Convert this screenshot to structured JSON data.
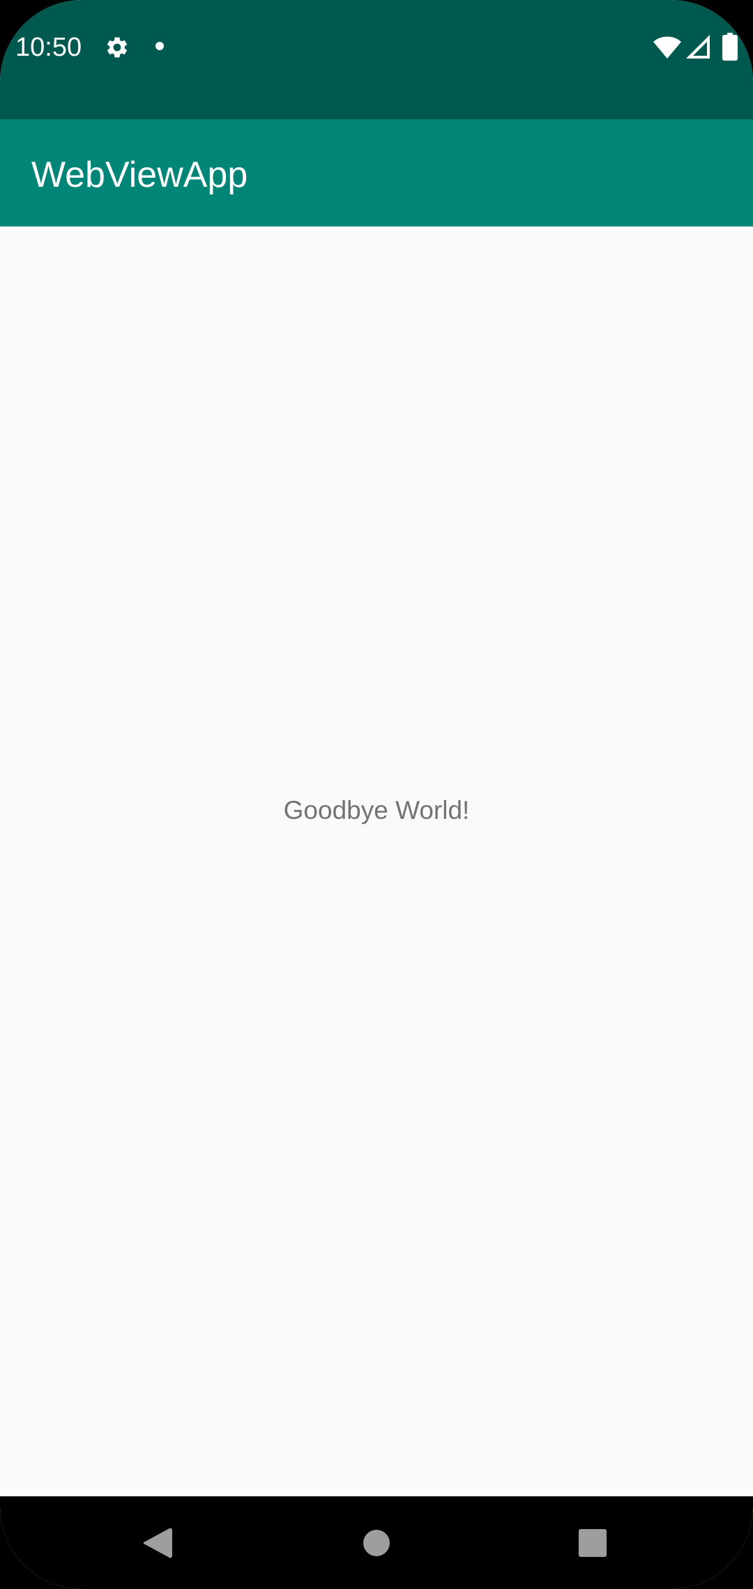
{
  "status_bar": {
    "time": "10:50",
    "icons": [
      "gear-icon",
      "dot-icon",
      "wifi-icon",
      "signal-icon",
      "battery-icon"
    ]
  },
  "app_bar": {
    "title": "WebViewApp"
  },
  "content": {
    "text": "Goodbye World!"
  },
  "navigation": {
    "icons": [
      "back-icon",
      "home-icon",
      "recents-icon"
    ]
  },
  "colors": {
    "status_bar": "#00594E",
    "app_bar": "#008577",
    "background": "#FAFAFA",
    "text": "#737373",
    "nav_bar": "#000000",
    "nav_icon": "#9E9E9E"
  }
}
